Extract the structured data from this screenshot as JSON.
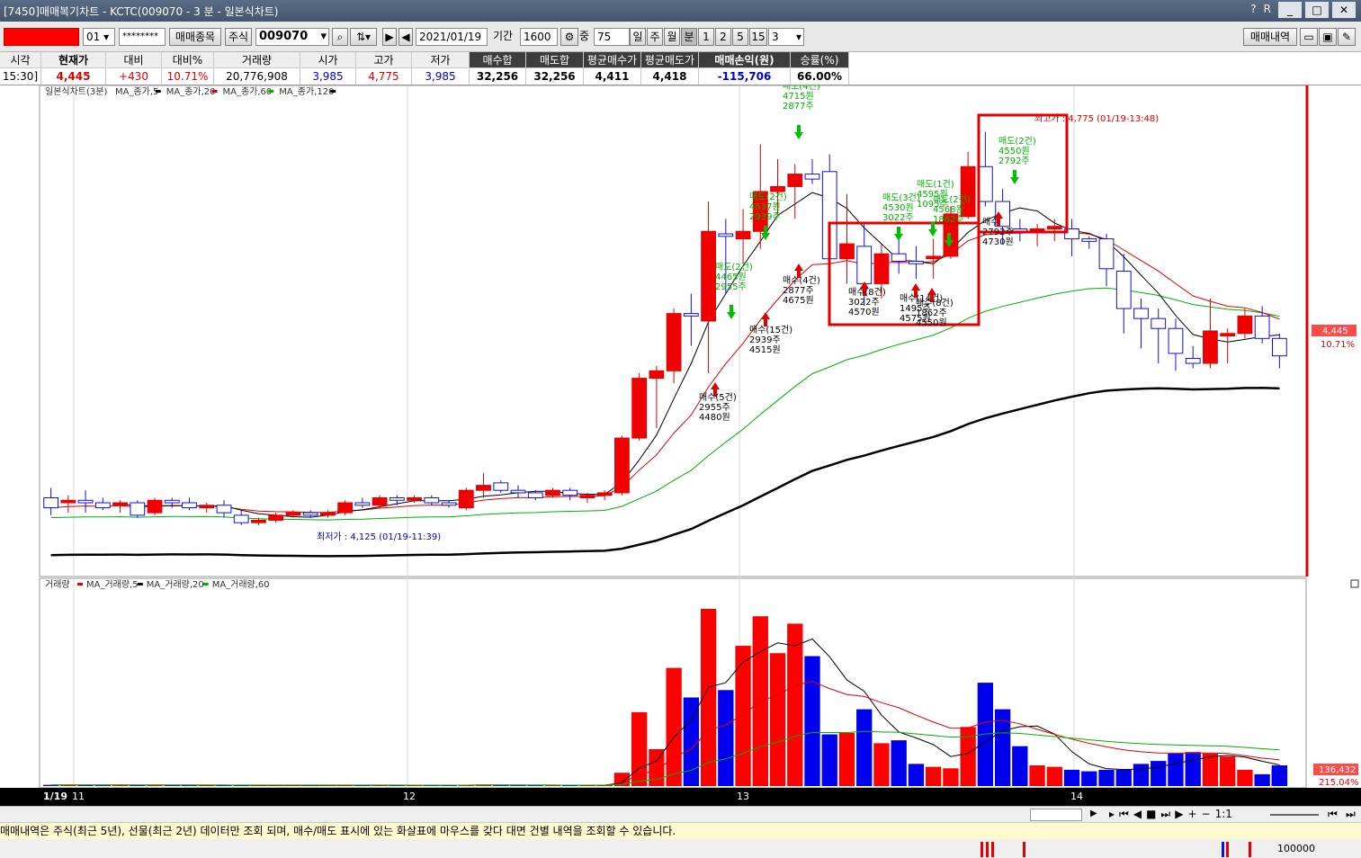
{
  "window": {
    "title": "[7450]매매복기차트 - KCTC(009070 - 3 분 - 일본식차트)",
    "icons": [
      "?",
      "R",
      "_"
    ]
  },
  "toolbar": {
    "account_select": "01",
    "password_mask": "********",
    "trade_item_button": "매매종목",
    "type_label": "주식",
    "code": "009070",
    "date": "2021/01/19",
    "period_label": "기간",
    "period_value": "1600",
    "middle_label": "중",
    "middle_value": "75",
    "unit_day": "일",
    "unit_week": "주",
    "unit_month": "월",
    "unit_minute": "분",
    "minute_buttons": [
      "1",
      "2",
      "5",
      "15"
    ],
    "minute_select": "3",
    "trade_history_button": "매매내역"
  },
  "info": {
    "row0_label": "시각",
    "row0_value": "15:30]",
    "headers": [
      "현재가",
      "대비",
      "대비%",
      "거래량",
      "시가",
      "고가",
      "저가",
      "매수합",
      "매도합",
      "평균매수가",
      "평균매도가",
      "매매손익(원)",
      "승률(%)"
    ],
    "values": [
      "4,445",
      "+430",
      "10.71%",
      "20,776,908",
      "3,985",
      "4,775",
      "3,985",
      "32,256",
      "32,256",
      "4,411",
      "4,418",
      "-115,706",
      "66.00%"
    ],
    "colors": {
      "up": "#e00000",
      "down": "#0000d0",
      "black": "#000000"
    }
  },
  "chart_data": [
    {
      "type": "candlestick",
      "title": "일본식차트(3분)",
      "legend": [
        "MA_종가,5",
        "MA_종가,20",
        "MA_종가,60",
        "MA_종가,120"
      ],
      "legend_colors": [
        "#000000",
        "#e00000",
        "#00b000",
        "#000000"
      ],
      "ylim": [
        3900,
        4850
      ],
      "candles": [
        [
          4040,
          4060,
          4005,
          4020
        ],
        [
          4030,
          4045,
          4010,
          4035
        ],
        [
          4035,
          4055,
          4010,
          4030
        ],
        [
          4030,
          4040,
          4015,
          4020
        ],
        [
          4025,
          4035,
          4010,
          4030
        ],
        [
          4030,
          4035,
          4000,
          4005
        ],
        [
          4010,
          4040,
          4005,
          4035
        ],
        [
          4035,
          4040,
          4020,
          4030
        ],
        [
          4030,
          4040,
          4015,
          4020
        ],
        [
          4020,
          4030,
          4010,
          4025
        ],
        [
          4025,
          4035,
          4000,
          4010
        ],
        [
          4005,
          4015,
          3985,
          3990
        ],
        [
          3990,
          4000,
          3985,
          3995
        ],
        [
          3995,
          4010,
          3990,
          4005
        ],
        [
          4005,
          4015,
          4000,
          4010
        ],
        [
          4010,
          4015,
          4000,
          4005
        ],
        [
          4005,
          4015,
          4000,
          4010
        ],
        [
          4010,
          4035,
          4005,
          4030
        ],
        [
          4030,
          4040,
          4020,
          4025
        ],
        [
          4025,
          4045,
          4020,
          4040
        ],
        [
          4040,
          4045,
          4025,
          4035
        ],
        [
          4035,
          4045,
          4030,
          4040
        ],
        [
          4040,
          4045,
          4025,
          4030
        ],
        [
          4030,
          4035,
          4020,
          4025
        ],
        [
          4020,
          4060,
          4015,
          4055
        ],
        [
          4055,
          4090,
          4040,
          4065
        ],
        [
          4070,
          4075,
          4050,
          4055
        ],
        [
          4055,
          4065,
          4040,
          4050
        ],
        [
          4050,
          4055,
          4035,
          4040
        ],
        [
          4045,
          4060,
          4040,
          4055
        ],
        [
          4055,
          4060,
          4035,
          4045
        ],
        [
          4040,
          4050,
          4030,
          4045
        ],
        [
          4045,
          4055,
          4035,
          4050
        ],
        [
          4050,
          4165,
          4045,
          4160
        ],
        [
          4160,
          4290,
          4155,
          4280
        ],
        [
          4280,
          4305,
          4180,
          4295
        ],
        [
          4295,
          4420,
          4270,
          4410
        ],
        [
          4410,
          4450,
          4345,
          4405
        ],
        [
          4395,
          4635,
          4290,
          4575
        ],
        [
          4570,
          4600,
          4450,
          4565
        ],
        [
          4560,
          4620,
          4510,
          4575
        ],
        [
          4575,
          4750,
          4540,
          4655
        ],
        [
          4655,
          4720,
          4610,
          4665
        ],
        [
          4665,
          4710,
          4600,
          4690
        ],
        [
          4690,
          4720,
          4670,
          4680
        ],
        [
          4695,
          4730,
          4490,
          4520
        ],
        [
          4520,
          4650,
          4470,
          4550
        ],
        [
          4545,
          4590,
          4425,
          4470
        ],
        [
          4470,
          4550,
          4440,
          4530
        ],
        [
          4530,
          4570,
          4490,
          4515
        ],
        [
          4515,
          4545,
          4480,
          4510
        ],
        [
          4520,
          4560,
          4480,
          4525
        ],
        [
          4525,
          4625,
          4520,
          4610
        ],
        [
          4605,
          4735,
          4600,
          4705
        ],
        [
          4705,
          4775,
          4625,
          4635
        ],
        [
          4635,
          4660,
          4550,
          4585
        ],
        [
          4580,
          4600,
          4555,
          4575
        ],
        [
          4575,
          4590,
          4545,
          4580
        ],
        [
          4580,
          4600,
          4555,
          4585
        ],
        [
          4580,
          4600,
          4525,
          4560
        ],
        [
          4560,
          4565,
          4540,
          4555
        ],
        [
          4560,
          4570,
          4465,
          4500
        ],
        [
          4495,
          4530,
          4370,
          4420
        ],
        [
          4420,
          4440,
          4340,
          4400
        ],
        [
          4400,
          4420,
          4310,
          4380
        ],
        [
          4380,
          4400,
          4295,
          4330
        ],
        [
          4320,
          4345,
          4300,
          4310
        ],
        [
          4310,
          4440,
          4300,
          4375
        ],
        [
          4365,
          4380,
          4310,
          4370
        ],
        [
          4370,
          4420,
          4360,
          4405
        ],
        [
          4405,
          4425,
          4350,
          4360
        ],
        [
          4360,
          4370,
          4300,
          4325
        ]
      ],
      "annotations": [
        {
          "text": "최고가 : 4,775 (01/19-13:48)",
          "color": "#e00000"
        },
        {
          "text": "최저가 : 4,125 (01/19-11:39)",
          "color": "#0000d0"
        },
        {
          "text": "매수(5건) 2955주 4480원",
          "side": "buy"
        },
        {
          "text": "매도(2건) 4465원 2955주",
          "side": "sell"
        },
        {
          "text": "매수(15건) 2939주 4515원",
          "side": "buy"
        },
        {
          "text": "매도(2건) 4537원 2939주",
          "side": "sell"
        },
        {
          "text": "매수(4건) 2877주 4675원",
          "side": "buy"
        },
        {
          "text": "매도(4건) 4715원 2877주",
          "side": "sell"
        },
        {
          "text": "매수(8건) 3022주 4570원",
          "side": "buy"
        },
        {
          "text": "매도(3건) 4530원 3022주",
          "side": "sell"
        },
        {
          "text": "매수(14건) 1495주 4575원",
          "side": "buy"
        },
        {
          "text": "매도(1건) 4595원 1095주",
          "side": "sell"
        },
        {
          "text": "매수(8건) 1862주 4550원",
          "side": "buy"
        },
        {
          "text": "매도(2건) 4568원 1862주",
          "side": "sell"
        },
        {
          "text": "매수 2792주 4730원",
          "side": "buy"
        },
        {
          "text": "매도(2건) 4550원 2792주",
          "side": "sell"
        }
      ],
      "price_label": "4,445",
      "price_pct": "10.71%"
    },
    {
      "type": "bar",
      "title": "거래량",
      "legend": [
        "MA_거래량,5",
        "MA_거래량,20",
        "MA_거래량,60"
      ],
      "legend_colors": [
        "#e00000",
        "#000000",
        "#00b000"
      ],
      "ylim": [
        0,
        1200000
      ],
      "values": [
        8000,
        6000,
        7000,
        5000,
        6000,
        5500,
        7000,
        6500,
        5000,
        4500,
        6000,
        4000,
        4000,
        5000,
        6000,
        5000,
        4500,
        7000,
        5000,
        6000,
        5500,
        6000,
        5000,
        5000,
        9000,
        10000,
        6000,
        5000,
        5000,
        6000,
        5000,
        5000,
        6000,
        90000,
        500000,
        250000,
        800000,
        600000,
        1200000,
        650000,
        950000,
        1150000,
        900000,
        1100000,
        880000,
        350000,
        360000,
        520000,
        290000,
        310000,
        150000,
        130000,
        120000,
        400000,
        700000,
        520000,
        270000,
        140000,
        130000,
        110000,
        100000,
        110000,
        110000,
        150000,
        170000,
        220000,
        230000,
        220000,
        200000,
        110000,
        80000,
        105000,
        120000,
        140000
      ],
      "value_label": "136,432",
      "pct_label": "215.04%"
    }
  ],
  "time_axis": {
    "labels": [
      "1/19",
      "11",
      "12",
      "13",
      "14"
    ]
  },
  "scrollbar": {
    "icons": [
      "play-icon",
      "first-icon",
      "prev-icon",
      "stop-icon",
      "next-icon",
      "last-icon",
      "zoom-in-icon",
      "zoom-out-icon"
    ],
    "ratio_label": "1:1"
  },
  "notice": {
    "text": "매매내역은 주식(최근 5년), 선물(최근 2년) 데이터만 조회 되며, 매수/매도 표시에 있는 화살표에 마우스를 갖다 대면 건별 내역을 조회할 수 있습니다."
  },
  "bottom": {
    "scale_label": "100000"
  }
}
